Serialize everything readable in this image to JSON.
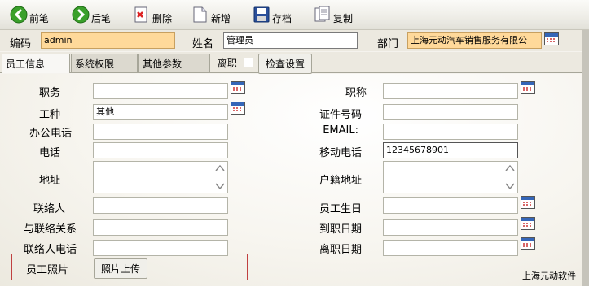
{
  "toolbar": {
    "prev": "前笔",
    "next": "后笔",
    "delete": "删除",
    "add": "新增",
    "save": "存档",
    "copy": "复制"
  },
  "header": {
    "code_label": "编码",
    "code_value": "admin",
    "name_label": "姓名",
    "name_value": "管理员",
    "dept_label": "部门",
    "dept_value": "上海元动汽车销售服务有限公"
  },
  "tabs": [
    "员工信息",
    "系统权限",
    "其他参数"
  ],
  "resigned_label": "离职",
  "check_settings": "检查设置",
  "form": {
    "left": [
      {
        "label": "职务",
        "value": ""
      },
      {
        "label": "工种",
        "value": "其他"
      },
      {
        "label": "办公电话",
        "value": ""
      },
      {
        "label": "电话",
        "value": ""
      },
      {
        "label": "地址",
        "value": ""
      },
      {
        "label": "联络人",
        "value": ""
      },
      {
        "label": "与联络关系",
        "value": ""
      },
      {
        "label": "联络人电话",
        "value": ""
      }
    ],
    "right": [
      {
        "label": "职称",
        "value": ""
      },
      {
        "label": "证件号码",
        "value": ""
      },
      {
        "label": "EMAIL:",
        "value": ""
      },
      {
        "label": "移动电话",
        "value": "12345678901"
      },
      {
        "label": "户籍地址",
        "value": ""
      },
      {
        "label": "员工生日",
        "value": ""
      },
      {
        "label": "到职日期",
        "value": ""
      },
      {
        "label": "离职日期",
        "value": ""
      }
    ],
    "photo_label": "员工照片",
    "photo_upload": "照片上传"
  },
  "footer_text": "上海元动软件"
}
